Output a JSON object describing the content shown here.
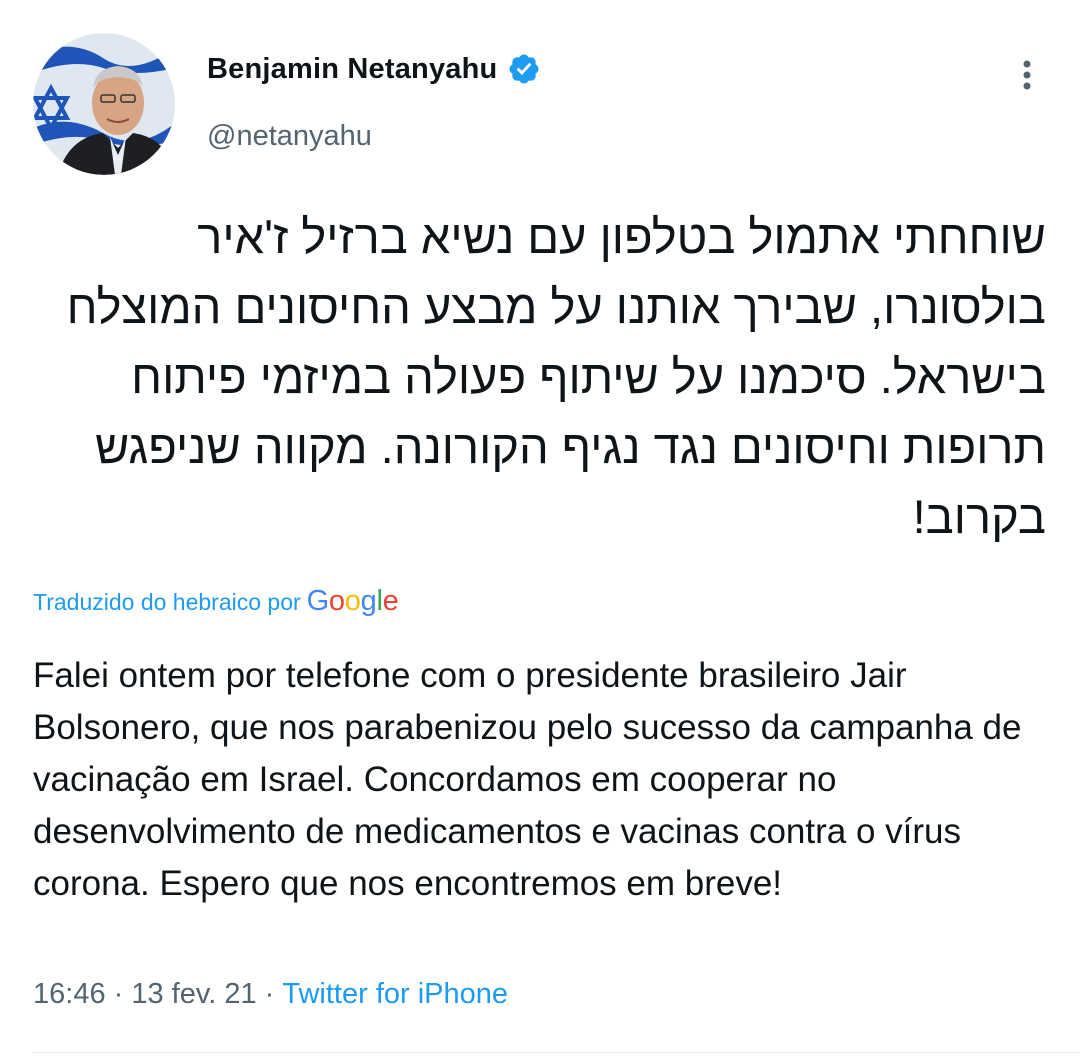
{
  "author": {
    "display_name": "Benjamin Netanyahu",
    "handle": "@netanyahu",
    "verified": true,
    "avatar_icon": "profile-photo"
  },
  "menu": {
    "icon": "more-vertical-icon"
  },
  "tweet": {
    "original_text": "שוחחתי אתמול בטלפון עם נשיא ברזיל ז'איר בולסונרו, שבירך אותנו על מבצע החיסונים המוצלח בישראל. סיכמנו על שיתוף פעולה במיזמי פיתוח תרופות וחיסונים נגד נגיף הקורונה. מקווה שניפגש בקרוב!",
    "translation_label": "Traduzido do hebraico por",
    "translation_provider": "Google",
    "translated_text": "Falei ontem por telefone com o presidente brasileiro Jair Bolsonero, que nos parabenizou pelo sucesso da campanha de vacinação em Israel. Concordamos em cooperar no desenvolvimento de medicamentos e vacinas contra o vírus corona. Espero que nos encontremos em breve!"
  },
  "meta": {
    "time": "16:46",
    "separator": " · ",
    "date": "13 fev. 21",
    "source": "Twitter for iPhone"
  },
  "colors": {
    "accent": "#1d9bf0",
    "text_primary": "#0f1419",
    "text_secondary": "#536471"
  }
}
